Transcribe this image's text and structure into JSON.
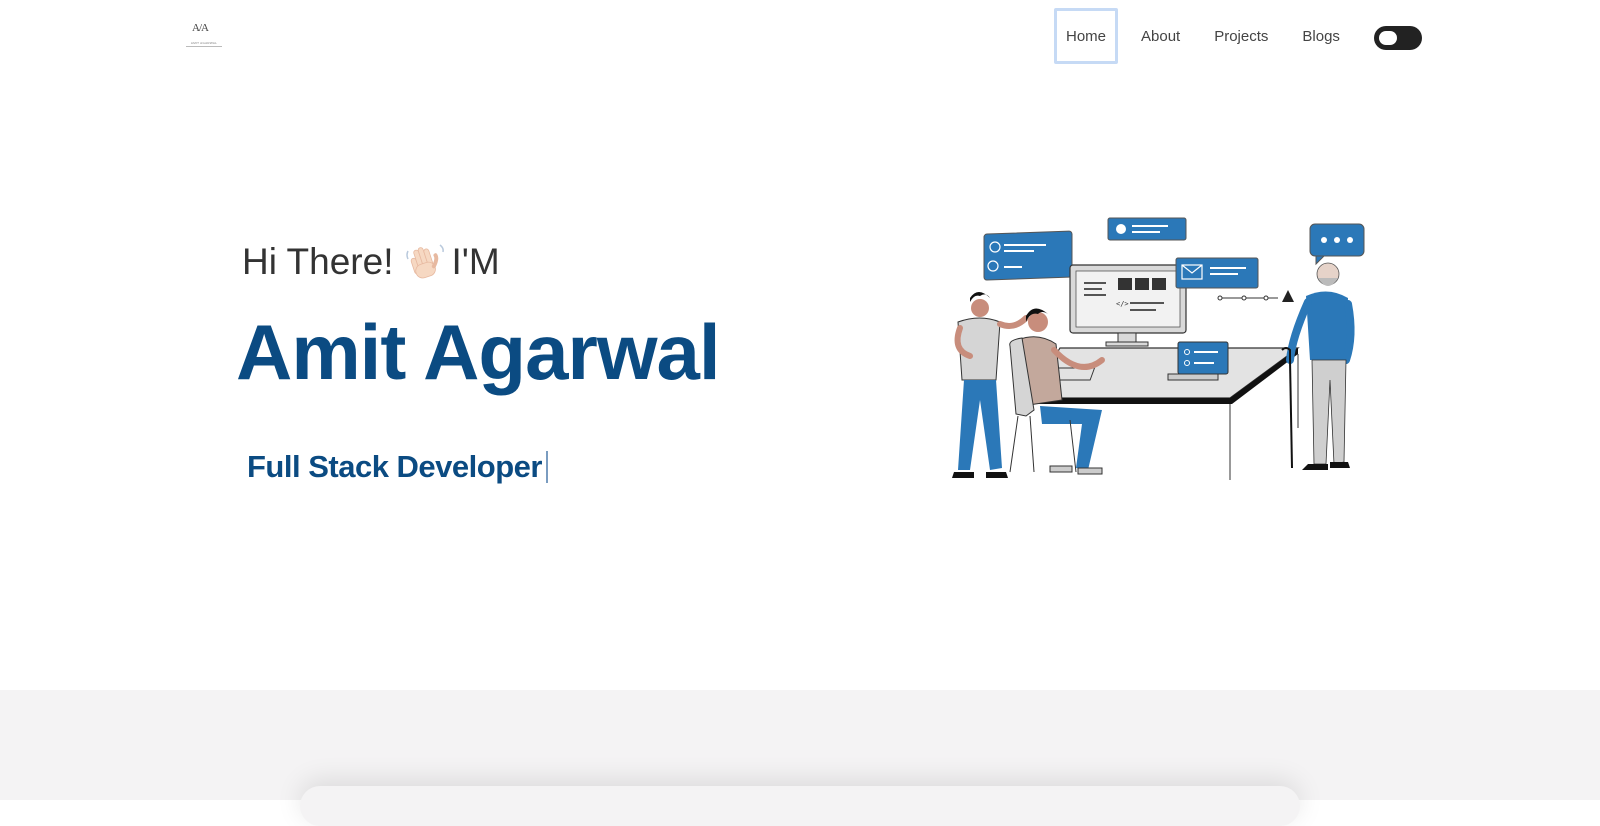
{
  "navbar": {
    "logo": {
      "monogram": "A/A",
      "line1": "AMIT AGARWAL"
    },
    "links": [
      {
        "label": "Home",
        "active": true
      },
      {
        "label": "About",
        "active": false
      },
      {
        "label": "Projects",
        "active": false
      },
      {
        "label": "Blogs",
        "active": false
      }
    ],
    "theme_toggle": {
      "state": "light"
    }
  },
  "hero": {
    "greeting_before": "Hi There!",
    "greeting_after": "I'M",
    "wave_icon": "waving-hand-emoji",
    "name": "Amit Agarwal",
    "role": "Full Stack Developer",
    "illustration": "developers-at-computer-illustration"
  },
  "colors": {
    "accent": "#0b4b82",
    "illustration_blue": "#2b78b8",
    "lower_background": "#f4f3f4",
    "active_outline": "#c6daf5"
  }
}
